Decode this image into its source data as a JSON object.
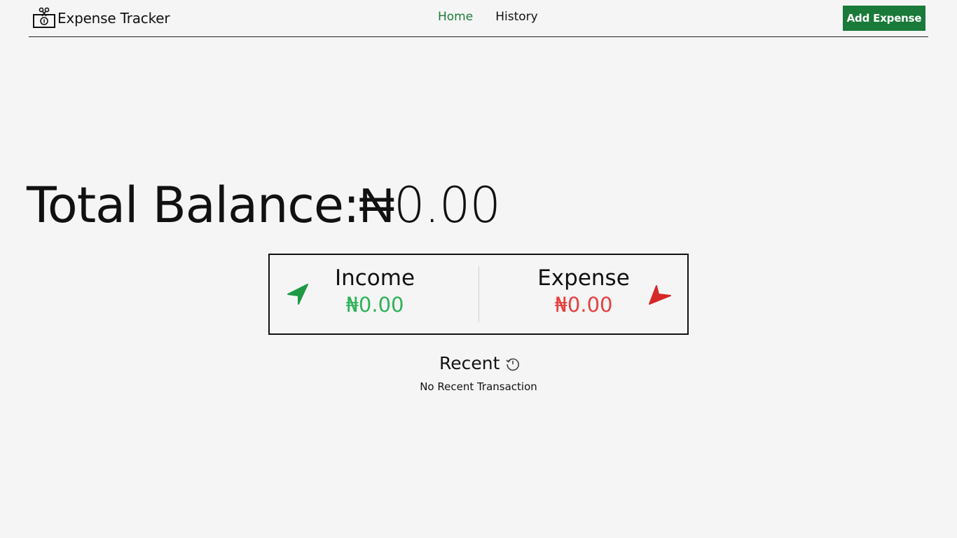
{
  "app": {
    "brand_name": "Expense Tracker",
    "brand_icon": "money-scissors-icon"
  },
  "nav": {
    "links": [
      {
        "label": "Home",
        "active": true
      },
      {
        "label": "History",
        "active": false
      }
    ],
    "add_button_label": "Add Expense"
  },
  "balance": {
    "label": "Total Balance:",
    "value": "₦0.00"
  },
  "summary": {
    "income": {
      "label": "Income",
      "amount": "₦0.00",
      "icon": "arrow-up-right-icon"
    },
    "expense": {
      "label": "Expense",
      "amount": "₦0.00",
      "icon": "arrow-down-right-icon"
    }
  },
  "recent": {
    "title": "Recent",
    "icon": "history-icon",
    "empty_message": "No Recent Transaction"
  },
  "colors": {
    "accent": "#1a7a3a",
    "active_link": "#1e7a3c",
    "income": "#2fb25a",
    "expense": "#e5403f",
    "background": "#f5f5f5"
  }
}
